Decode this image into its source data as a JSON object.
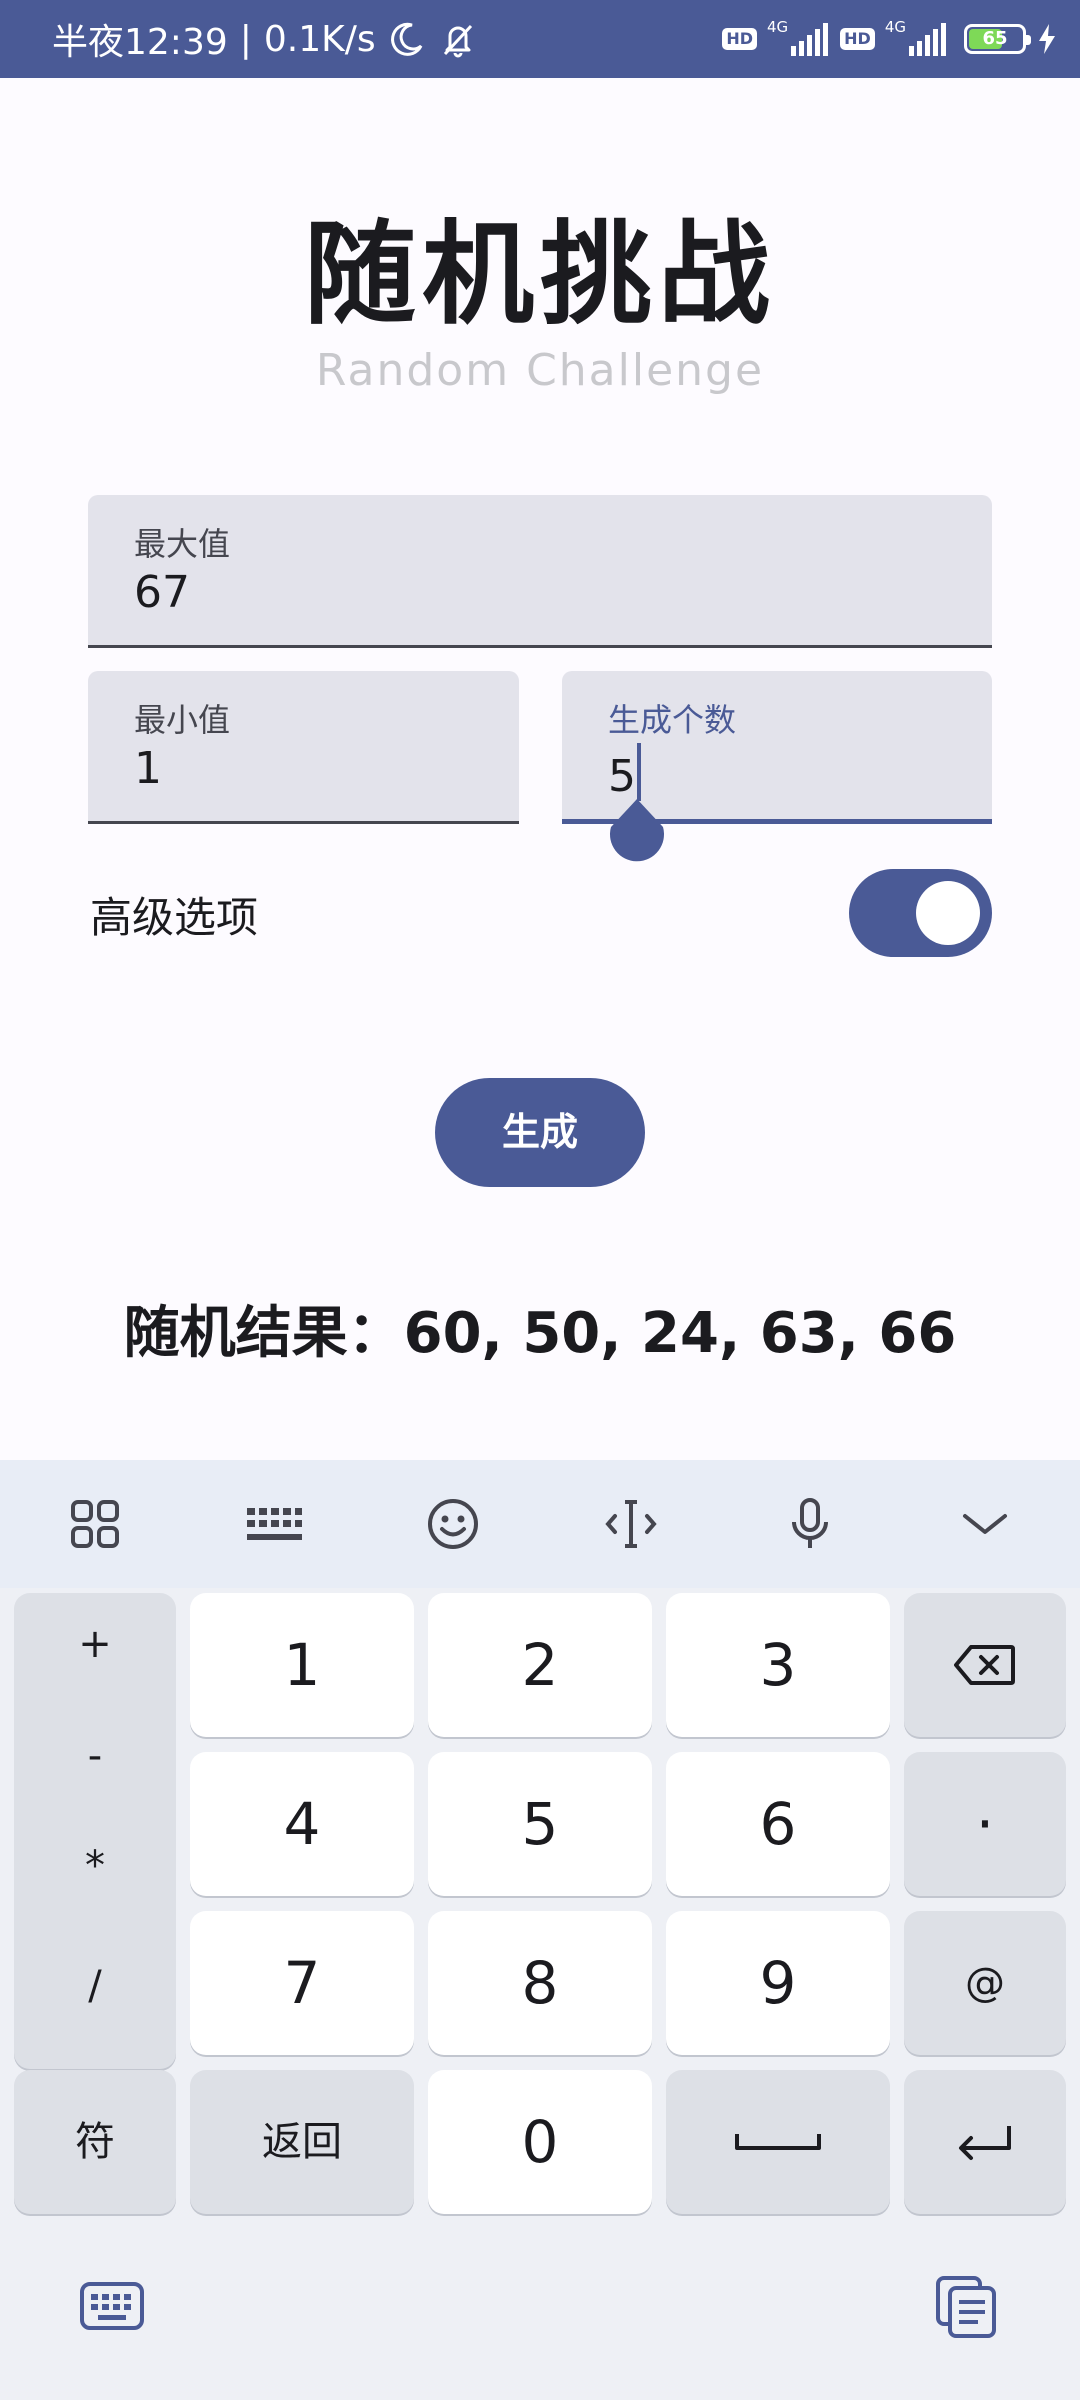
{
  "status_bar": {
    "time": "半夜12:39",
    "speed": "0.1K/s",
    "hd1": "HD",
    "gen1": "4G",
    "hd2": "HD",
    "gen2": "4G",
    "battery": "65",
    "battery_level_percent": 65
  },
  "header": {
    "title": "随机挑战",
    "subtitle": "Random Challenge"
  },
  "form": {
    "max": {
      "label": "最大值",
      "value": "67"
    },
    "min": {
      "label": "最小值",
      "value": "1"
    },
    "count": {
      "label": "生成个数",
      "value": "5"
    },
    "advanced": {
      "label": "高级选项",
      "enabled": true
    }
  },
  "actions": {
    "generate": "生成"
  },
  "result": {
    "text": "随机结果：60, 50, 24, 63, 66"
  },
  "keyboard": {
    "toolbar": [
      "grid-icon",
      "keyboard-layout-icon",
      "emoji-icon",
      "cursor-icon",
      "mic-icon",
      "collapse-icon"
    ],
    "symbols": [
      "+",
      "-",
      "*",
      "/"
    ],
    "digits": [
      "1",
      "2",
      "3",
      "4",
      "5",
      "6",
      "7",
      "8",
      "9",
      "0"
    ],
    "dot": "·",
    "at": "@",
    "fu": "符",
    "back": "返回"
  },
  "colors": {
    "primary": "#4a5a96",
    "field_bg": "#e3e3eb",
    "background": "#fdfbff"
  }
}
